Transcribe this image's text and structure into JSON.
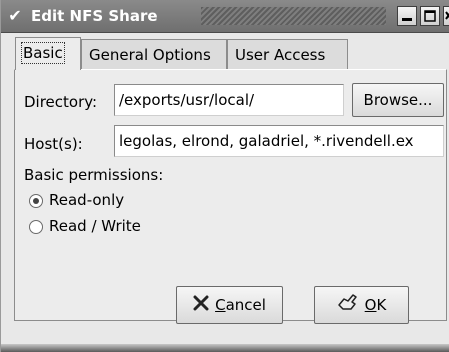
{
  "window": {
    "title": "Edit NFS Share",
    "menu_icon": "chevron-down-icon",
    "controls": [
      "minimize-icon",
      "maximize-icon",
      "close-icon"
    ]
  },
  "tabs": [
    {
      "label": "Basic",
      "active": true
    },
    {
      "label": "General Options",
      "active": false
    },
    {
      "label": "User Access",
      "active": false
    }
  ],
  "form": {
    "directory_label": "Directory:",
    "directory_value": "/exports/usr/local/",
    "browse_label": "Browse...",
    "hosts_label": "Host(s):",
    "hosts_value": "legolas, elrond, galadriel, *.rivendell.ex",
    "permissions_label": "Basic permissions:",
    "options": [
      {
        "label": "Read-only",
        "selected": true
      },
      {
        "label": "Read / Write",
        "selected": false
      }
    ]
  },
  "buttons": {
    "cancel_mnemonic": "C",
    "cancel_rest": "ancel",
    "cancel_icon": "cancel-x-icon",
    "ok_mnemonic": "O",
    "ok_rest": "K",
    "ok_icon": "ok-hand-icon"
  }
}
